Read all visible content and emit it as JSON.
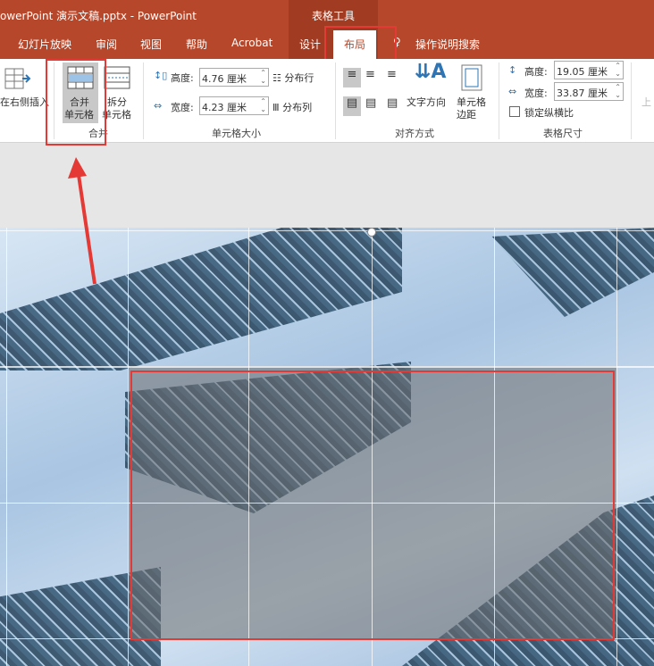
{
  "titlebar": {
    "title": "owerPoint 演示文稿.pptx  -  PowerPoint",
    "context_group": "表格工具"
  },
  "tabs": [
    "幻灯片放映",
    "审阅",
    "视图",
    "帮助",
    "Acrobat",
    "设计",
    "布局"
  ],
  "active_tab": "布局",
  "tell_me": "操作说明搜索",
  "ribbon": {
    "insert_right": "在右侧插入",
    "merge": {
      "merge_cells": [
        "合并",
        "单元格"
      ],
      "split_cells": [
        "拆分",
        "单元格"
      ],
      "group": "合并"
    },
    "cell_size": {
      "height_label": "高度:",
      "height_value": "4.76 厘米",
      "width_label": "宽度:",
      "width_value": "4.23 厘米",
      "distribute_rows": "分布行",
      "distribute_cols": "分布列",
      "group": "单元格大小"
    },
    "alignment": {
      "text_direction": "文字方向",
      "cell_margins": [
        "单元格",
        "边距"
      ],
      "group": "对齐方式"
    },
    "table_size": {
      "height_label": "高度:",
      "height_value": "19.05 厘米",
      "width_label": "宽度:",
      "width_value": "33.87 厘米",
      "lock_ratio": "锁定纵横比",
      "group": "表格尺寸"
    },
    "arrange_partial": "上"
  },
  "colors": {
    "accent": "#b7472a",
    "highlight": "#e53935"
  }
}
